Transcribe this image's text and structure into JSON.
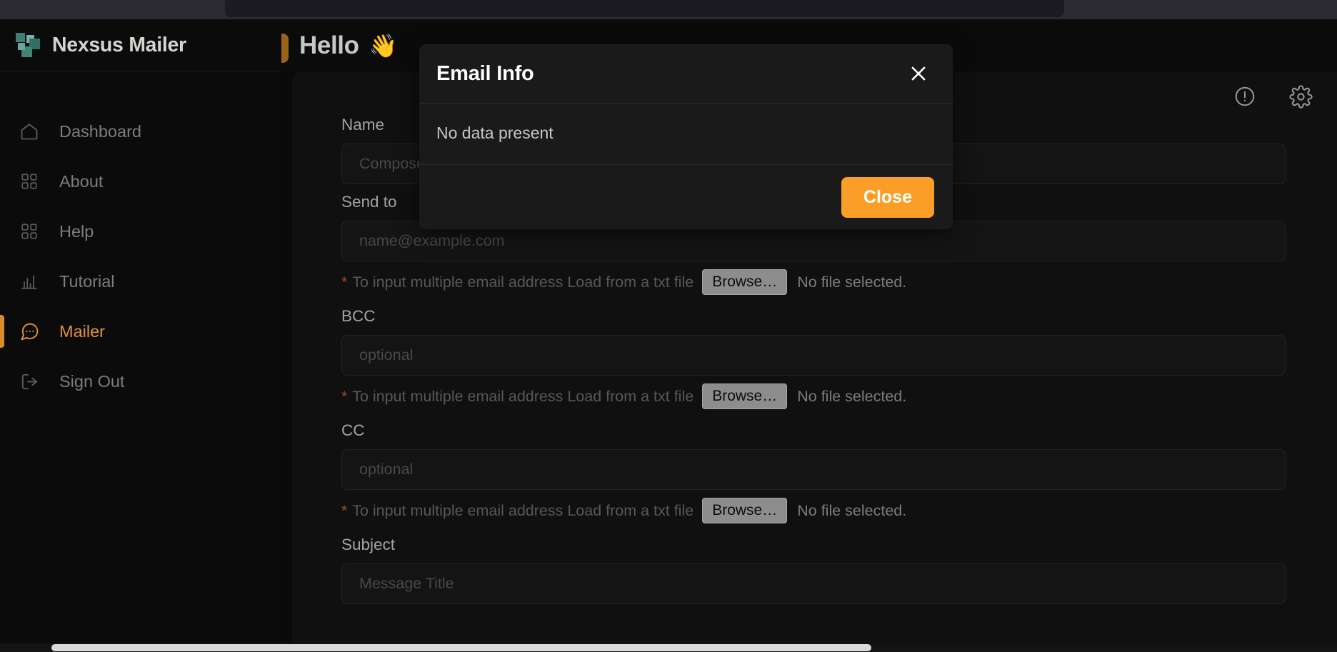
{
  "app": {
    "brand": "Nexsus Mailer",
    "logo_icon": "squares-logo-icon"
  },
  "sidebar": {
    "items": [
      {
        "label": "Dashboard",
        "icon": "home-icon",
        "active": false
      },
      {
        "label": "About",
        "icon": "grid-icon",
        "active": false
      },
      {
        "label": "Help",
        "icon": "grid-icon",
        "active": false
      },
      {
        "label": "Tutorial",
        "icon": "bar-chart-icon",
        "active": false
      },
      {
        "label": "Mailer",
        "icon": "chat-bubble-icon",
        "active": true
      },
      {
        "label": "Sign Out",
        "icon": "logout-icon",
        "active": false
      }
    ]
  },
  "topbar": {
    "back_icon": "arrow-left-icon",
    "greeting": "Hello",
    "wave_emoji": "👋"
  },
  "main": {
    "tools": [
      {
        "icon": "alert-circle-icon",
        "name": "info-button"
      },
      {
        "icon": "gear-icon",
        "name": "settings-button"
      }
    ],
    "hint_text": "To input multiple email address Load from a txt file",
    "required_marker": "*",
    "browse_label": "Browse…",
    "no_file_label": "No file selected.",
    "fields": [
      {
        "label": "Name",
        "placeholder": "Compose Name",
        "value": ""
      },
      {
        "label": "Send to",
        "placeholder": "name@example.com",
        "value": ""
      },
      {
        "label": "BCC",
        "placeholder": "optional",
        "value": ""
      },
      {
        "label": "CC",
        "placeholder": "optional",
        "value": ""
      },
      {
        "label": "Subject",
        "placeholder": "Message Title",
        "value": ""
      }
    ]
  },
  "modal": {
    "title": "Email Info",
    "body": "No data present",
    "close_button": "Close",
    "close_icon": "close-x-icon"
  },
  "colors": {
    "accent_orange": "#fb9e28",
    "active_orange": "#e0913a",
    "back_button": "#9a6418",
    "logo_teal": "#4c8d7f",
    "required_red": "#b0452e",
    "panel_bg": "#101010",
    "modal_bg": "#1a1a1a"
  }
}
